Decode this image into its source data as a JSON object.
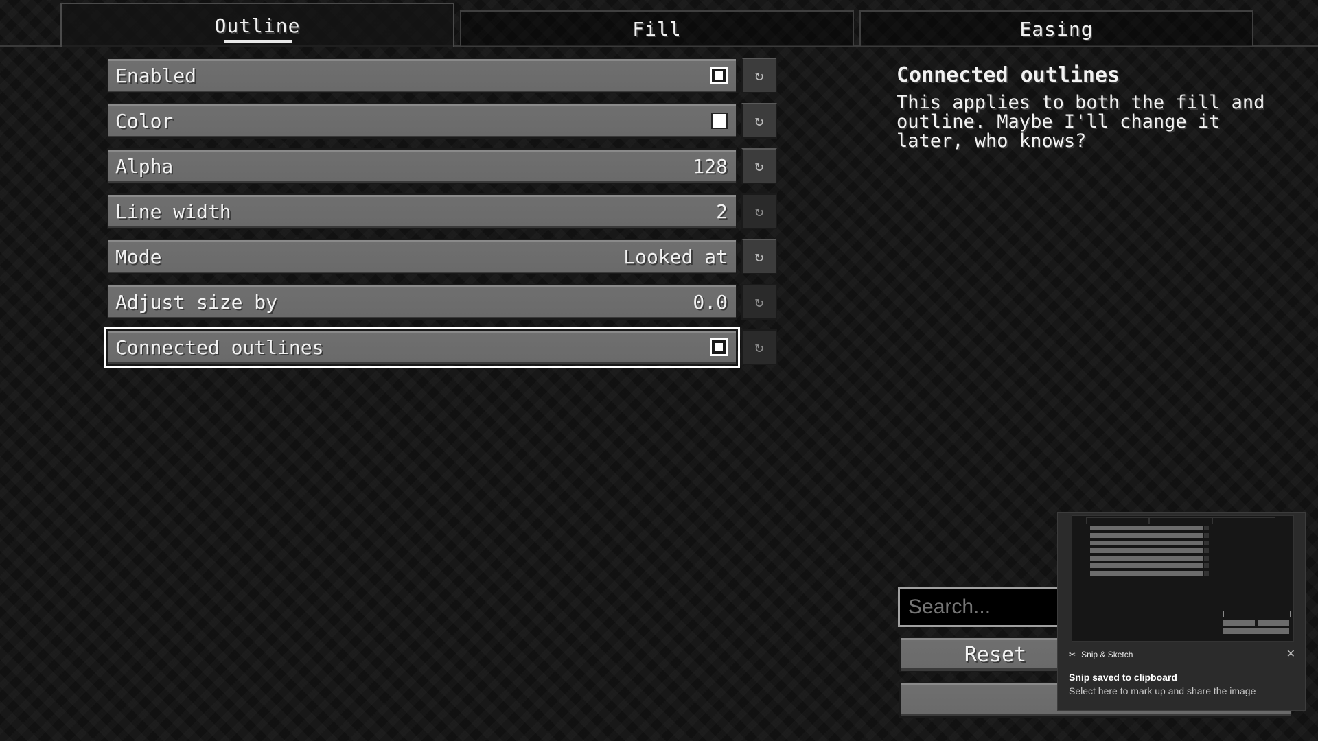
{
  "tabs": [
    {
      "label": "Outline",
      "active": true
    },
    {
      "label": "Fill",
      "active": false
    },
    {
      "label": "Easing",
      "active": false
    }
  ],
  "settings": [
    {
      "label": "Enabled",
      "control": "checkbox",
      "checked": true
    },
    {
      "label": "Color",
      "control": "color-swatch",
      "color": "#ffffff"
    },
    {
      "label": "Alpha",
      "control": "value",
      "value": "128"
    },
    {
      "label": "Line width",
      "control": "value",
      "value": "2"
    },
    {
      "label": "Mode",
      "control": "value",
      "value": "Looked at"
    },
    {
      "label": "Adjust size by",
      "control": "value",
      "value": "0.0"
    },
    {
      "label": "Connected outlines",
      "control": "checkbox",
      "checked": true,
      "selected": true
    }
  ],
  "reset_icon": "reset-arrow-icon",
  "description": {
    "title": "Connected outlines",
    "body": "This applies to both the fill and outline. Maybe I'll change it later, who knows?"
  },
  "search": {
    "placeholder": "Search..."
  },
  "buttons": {
    "reset": "Reset"
  },
  "toast": {
    "app_name": "Snip & Sketch",
    "title": "Snip saved to clipboard",
    "body": "Select here to mark up and share the image",
    "close_icon": "close-icon"
  },
  "colors": {
    "accent_white": "#ffffff",
    "row_gray": "#6c6c6c",
    "background": "#131313"
  }
}
